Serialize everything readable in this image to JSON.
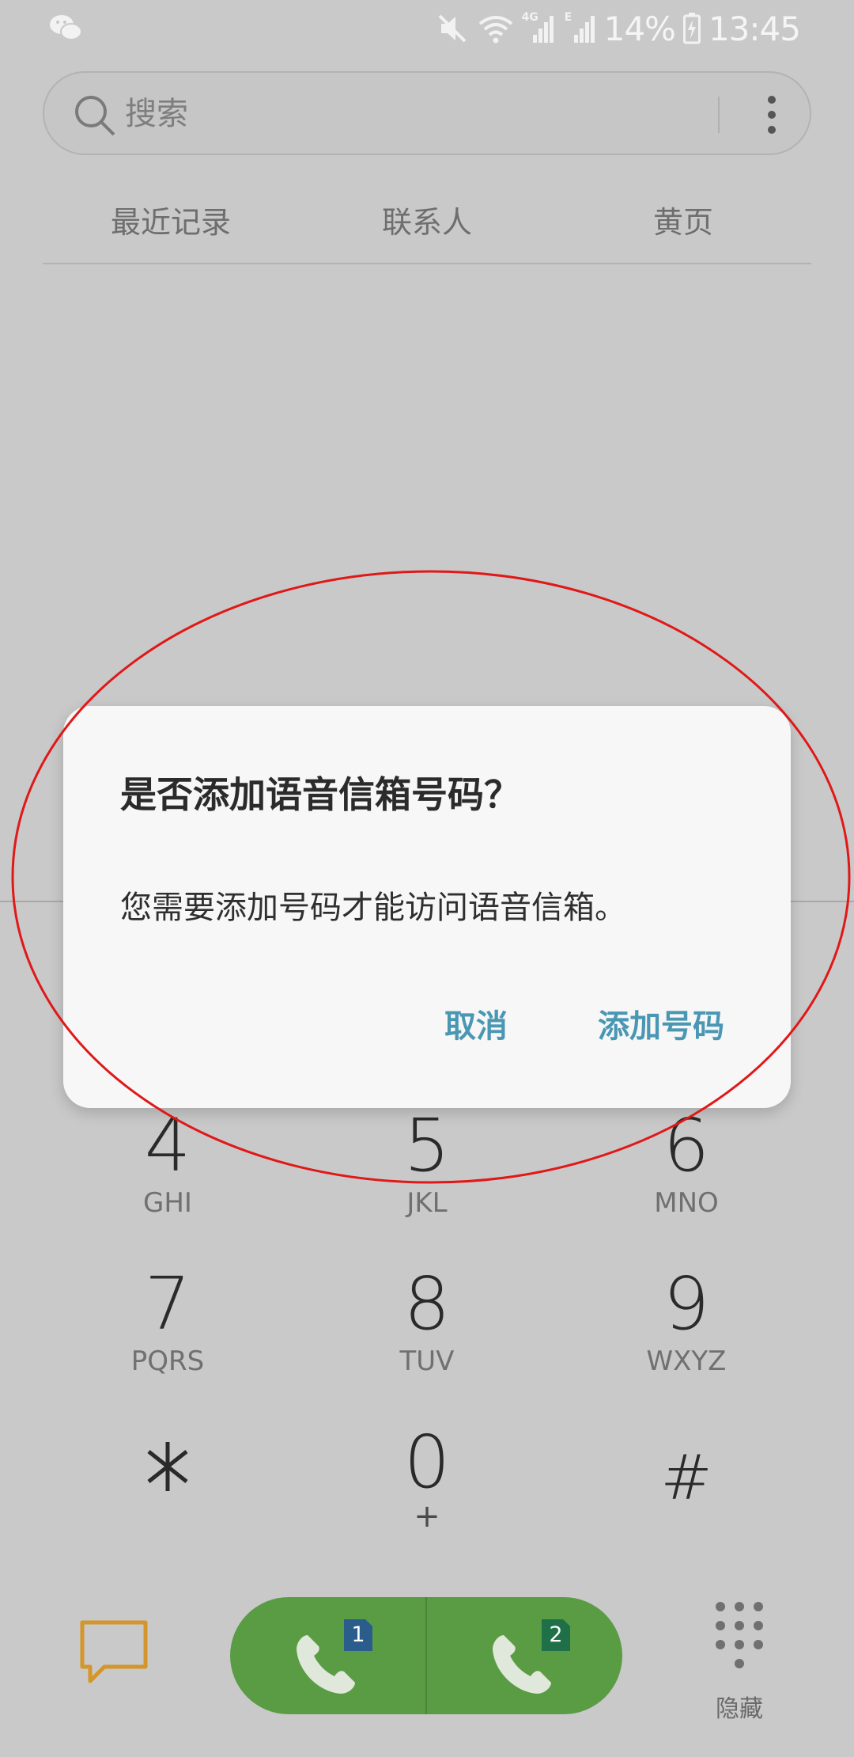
{
  "status_bar": {
    "battery": "14%",
    "time": "13:45",
    "network_4g": "4G",
    "network_e": "E",
    "icons": [
      "wechat-icon",
      "mute-icon",
      "wifi-icon",
      "signal-icon",
      "battery-icon"
    ]
  },
  "search": {
    "placeholder": "搜索"
  },
  "tabs": [
    {
      "label": "最近记录"
    },
    {
      "label": "联系人"
    },
    {
      "label": "黄页"
    }
  ],
  "keypad": {
    "keys": [
      {
        "digit": "4",
        "letters": "GHI"
      },
      {
        "digit": "5",
        "letters": "JKL"
      },
      {
        "digit": "6",
        "letters": "MNO"
      },
      {
        "digit": "7",
        "letters": "PQRS"
      },
      {
        "digit": "8",
        "letters": "TUV"
      },
      {
        "digit": "9",
        "letters": "WXYZ"
      },
      {
        "digit": "⁎",
        "letters": ""
      },
      {
        "digit": "0",
        "letters": "+"
      },
      {
        "digit": "#",
        "letters": ""
      }
    ]
  },
  "bottom_bar": {
    "sim1_label": "1",
    "sim2_label": "2",
    "hide_label": "隐藏",
    "call_color": "#5a9c44",
    "sim1_color": "#2a5c8c",
    "sim2_color": "#1f7048",
    "message_icon_color": "#d4952a"
  },
  "dialog": {
    "title": "是否添加语音信箱号码？",
    "message": "您需要添加号码才能访问语音信箱。",
    "cancel_label": "取消",
    "add_label": "添加号码",
    "accent_color": "#4a97b4"
  }
}
